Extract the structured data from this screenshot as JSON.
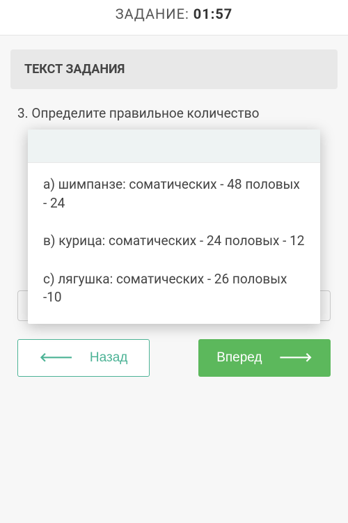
{
  "timer": {
    "label": "ЗАДАНИЕ: ",
    "value": "01:57"
  },
  "task": {
    "header": "ТЕКСТ ЗАДАНИЯ",
    "question": "3. Определите правильное количество"
  },
  "modal": {
    "options": [
      "a) шимпанзе: соматических - 48 половых - 24",
      "в) курица: соматических - 24 половых - 12",
      "с) лягушка: соматических - 26 половых -10"
    ]
  },
  "nav": {
    "back": "Назад",
    "forward": "Вперед"
  }
}
